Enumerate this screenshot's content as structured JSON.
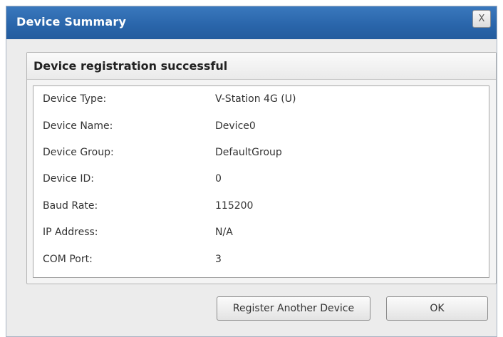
{
  "window": {
    "title": "Device Summary",
    "close_label": "X"
  },
  "panel": {
    "title": "Device registration successful",
    "rows": [
      {
        "label": "Device Type:",
        "value": "V-Station 4G (U)"
      },
      {
        "label": "Device Name:",
        "value": "Device0"
      },
      {
        "label": "Device Group:",
        "value": "DefaultGroup"
      },
      {
        "label": "Device ID:",
        "value": "0"
      },
      {
        "label": "Baud Rate:",
        "value": "115200"
      },
      {
        "label": "IP Address:",
        "value": "N/A"
      },
      {
        "label": "COM Port:",
        "value": "3"
      }
    ]
  },
  "buttons": {
    "register_another": "Register Another Device",
    "ok": "OK"
  },
  "colors": {
    "titlebar": "#2a66ab",
    "dialog_bg": "#ececec"
  }
}
